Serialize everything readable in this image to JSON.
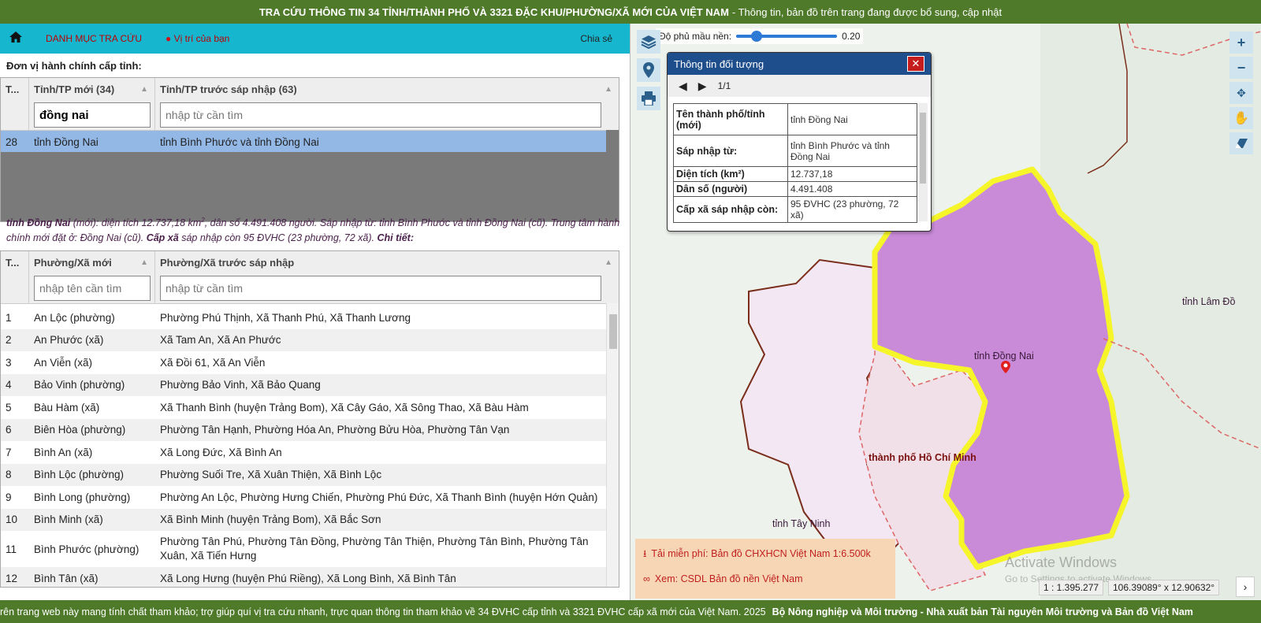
{
  "header": {
    "title_bold": "TRA CỨU THÔNG TIN 34 TỈNH/THÀNH PHỐ VÀ 3321 ĐẶC KHU/PHƯỜNG/XÃ MỚI CỦA VIỆT NAM",
    "title_rest": "- Thông tin, bản đồ trên trang đang được bổ sung, cập nhật"
  },
  "nav": {
    "home_icon": "home-icon",
    "menu_label": "DANH MỤC TRA CỨU",
    "location_label": "Vị trí của bạn",
    "share_label": "Chia sẻ"
  },
  "province_section": {
    "title": "Đơn vị hành chính cấp tỉnh:",
    "col_index": "T...",
    "col_new": "Tỉnh/TP mới (34)",
    "col_old": "Tỉnh/TP trước sáp nhập (63)",
    "filter_new_value": "đồng nai",
    "filter_old_placeholder": "nhập từ cần tìm",
    "rows": [
      {
        "index": "28",
        "new": "tỉnh Đồng Nai",
        "old": "tỉnh Bình Phước và tỉnh Đồng Nai"
      }
    ]
  },
  "summary": {
    "name": "tỉnh Đồng Nai",
    "part1": "(mới): diện tích 12.737,18 km",
    "sup": "2",
    "part2": ", dân số 4.491.408 người. Sáp nhập từ: tỉnh Bình Phước và tỉnh Đồng Nai (cũ). Trung tâm hành chính mới đặt ở: Đồng Nai (cũ).",
    "commune_label": "Cấp xã",
    "part3": "sáp nhập còn 95 ĐVHC (23 phường, 72 xã).",
    "detail_label": "Chi tiết:"
  },
  "commune_section": {
    "col_index": "T...",
    "col_new": "Phường/Xã mới",
    "col_old": "Phường/Xã trước sáp nhập",
    "filter_new_placeholder": "nhập tên cần tìm",
    "filter_old_placeholder": "nhập từ cần tìm",
    "rows": [
      {
        "index": "1",
        "new": "An Lộc (phường)",
        "old": "Phường Phú Thịnh, Xã Thanh Phú, Xã Thanh Lương"
      },
      {
        "index": "2",
        "new": "An Phước (xã)",
        "old": "Xã Tam An, Xã An Phước"
      },
      {
        "index": "3",
        "new": "An Viễn (xã)",
        "old": "Xã Đồi 61, Xã An Viễn"
      },
      {
        "index": "4",
        "new": "Bảo Vinh (phường)",
        "old": "Phường Bảo Vinh, Xã Bảo Quang"
      },
      {
        "index": "5",
        "new": "Bàu Hàm (xã)",
        "old": "Xã Thanh Bình (huyện Trảng Bom), Xã Cây Gáo, Xã Sông Thao, Xã Bàu Hàm"
      },
      {
        "index": "6",
        "new": "Biên Hòa (phường)",
        "old": "Phường Tân Hạnh, Phường Hóa An, Phường Bửu Hòa, Phường Tân Vạn"
      },
      {
        "index": "7",
        "new": "Bình An (xã)",
        "old": "Xã Long Đức, Xã Bình An"
      },
      {
        "index": "8",
        "new": "Bình Lộc (phường)",
        "old": "Phường Suối Tre, Xã Xuân Thiện, Xã Bình Lộc"
      },
      {
        "index": "9",
        "new": "Bình Long (phường)",
        "old": "Phường An Lộc, Phường Hưng Chiến, Phường Phú Đức, Xã Thanh Bình (huyện Hớn Quản)"
      },
      {
        "index": "10",
        "new": "Bình Minh (xã)",
        "old": "Xã Bình Minh (huyện Trảng Bom), Xã Bắc Sơn"
      },
      {
        "index": "11",
        "new": "Bình Phước (phường)",
        "old": "Phường Tân Phú, Phường Tân Đồng, Phường Tân Thiện, Phường Tân Bình, Phường Tân Xuân, Xã Tiến Hưng"
      },
      {
        "index": "12",
        "new": "Bình Tân (xã)",
        "old": "Xã Long Hưng (huyện Phú Riềng), Xã Long Bình, Xã Bình Tân"
      }
    ]
  },
  "map": {
    "opacity_label": "Độ phủ mầu nền:",
    "opacity_value": "0.20",
    "opacity_fraction": 0.2,
    "label_dongnai": "tỉnh Đồng Nai",
    "label_lamdong": "tỉnh Lâm Đồ",
    "label_hcm": "thành phố Hồ Chí Minh",
    "label_tayninh": "tỉnh Tây Ninh",
    "left_tools": [
      "layers-icon",
      "map-pin-icon",
      "print-icon"
    ],
    "right_tools": [
      "zoom-in-icon",
      "zoom-out-icon",
      "pan-icon",
      "hand-icon",
      "eraser-icon"
    ],
    "scale_text": "1 : 1.395.277",
    "coords_text": "106.39089° x 12.90632°",
    "watermark_line1": "Activate Windows",
    "watermark_line2": "Go to Settings to activate Windows.",
    "download_text": "Tải miễn phí: Bản đồ CHXHCN Việt Nam 1:6.500k",
    "view_text": "Xem: CSDL Bản đồ nền Việt Nam",
    "colors": {
      "province_fill": "#c98bd8",
      "province_border": "#f5f52a",
      "boundary": "#7a2d1a"
    }
  },
  "popup": {
    "title": "Thông tin đối tượng",
    "close": "✕",
    "pager": "1/1",
    "rows": [
      {
        "key": "Tên thành phố/tỉnh (mới)",
        "value": "tỉnh Đồng Nai"
      },
      {
        "key": "Sáp nhập từ:",
        "value": "tỉnh Bình Phước và tỉnh Đồng Nai"
      },
      {
        "key": "Diện tích (km²)",
        "value": "12.737,18"
      },
      {
        "key": "Dân số (người)",
        "value": "4.491.408"
      },
      {
        "key": "Cấp xã sáp nhập còn:",
        "value": "95 ĐVHC (23 phường, 72 xã)"
      }
    ]
  },
  "footer": {
    "text": "rên trang web này mang tính chất tham khảo; trợ giúp quí vị tra cứu nhanh, trực quan thông tin tham khảo về 34 ĐVHC cấp tỉnh và 3321 ĐVHC cấp xã mới của Việt Nam. 2025",
    "bold": "Bộ Nông nghiệp và Môi trường - Nhà xuất bản Tài nguyên Môi trường và Bản đồ Việt Nam"
  }
}
